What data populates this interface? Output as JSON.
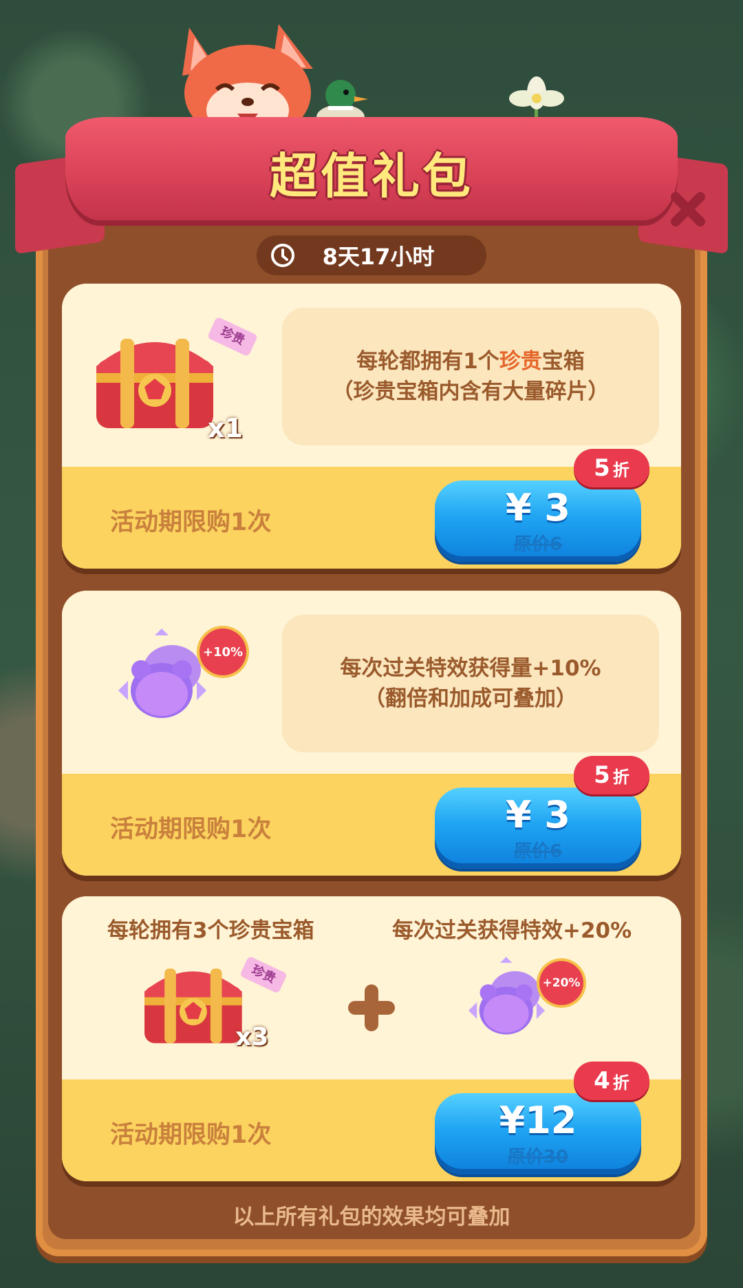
{
  "header": {
    "title": "超值礼包",
    "timer": "8天17小时"
  },
  "packs": [
    {
      "desc_line1_pre": "每轮都拥有1个",
      "desc_line1_hl": "珍贵",
      "desc_line1_post": "宝箱",
      "desc_line2": "（珍贵宝箱内含有大量碎片）",
      "item_tag": "珍贵",
      "item_qty": "x1",
      "limit": "活动期限购1次",
      "price": "¥ 3",
      "original": "原价6",
      "discount_num": "5",
      "discount_unit": "折"
    },
    {
      "desc_line1": "每次过关特效获得量+10%",
      "desc_line2": "（翻倍和加成可叠加）",
      "item_badge": "+10%",
      "limit": "活动期限购1次",
      "price": "¥ 3",
      "original": "原价6",
      "discount_num": "5",
      "discount_unit": "折"
    },
    {
      "left_label": "每轮拥有3个珍贵宝箱",
      "right_label": "每次过关获得特效+20%",
      "item_tag": "珍贵",
      "item_qty": "x3",
      "item_badge": "+20%",
      "limit": "活动期限购1次",
      "price": "¥12",
      "original": "原价30",
      "discount_num": "4",
      "discount_unit": "折"
    }
  ],
  "footer": "以上所有礼包的效果均可叠加",
  "colors": {
    "ribbon": "#d94157",
    "panel": "#8e4f2a",
    "button": "#1fa4f2",
    "badge": "#ea3b4e"
  }
}
